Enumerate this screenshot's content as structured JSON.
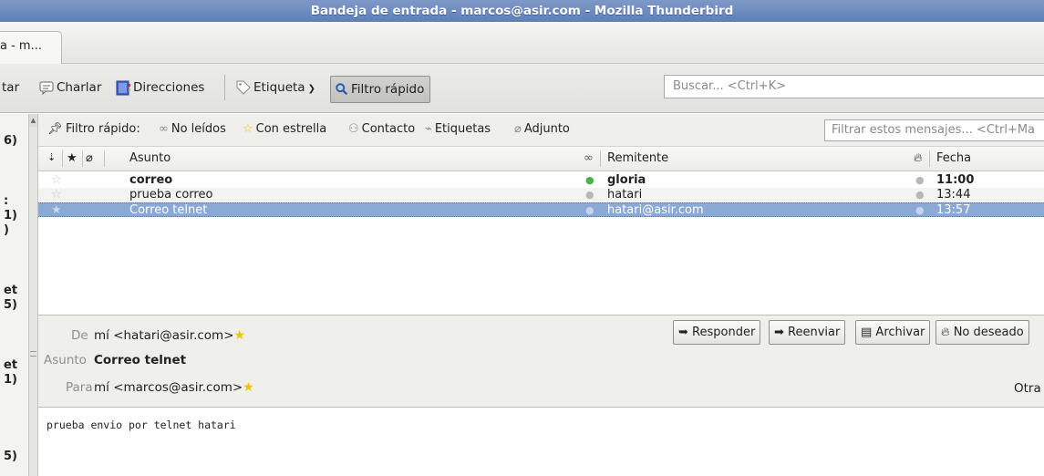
{
  "window": {
    "title": "Bandeja de entrada - marcos@asir.com - Mozilla Thunderbird"
  },
  "tab": {
    "label": "a - m..."
  },
  "toolbar": {
    "partial_label": "tar",
    "chat": "Charlar",
    "addresses": "Direcciones",
    "tag": "Etiqueta",
    "quick_filter": "Filtro rápido",
    "search_placeholder": "Buscar... <Ctrl+K>"
  },
  "folder_counts": [
    "6)",
    ":",
    "1)",
    ")",
    "et",
    "5)",
    "et",
    "1)",
    "5)"
  ],
  "quickfilter": {
    "label": "Filtro rápido:",
    "unread": "No leídos",
    "starred": "Con estrella",
    "contact": "Contacto",
    "tags": "Etiquetas",
    "attachment": "Adjunto",
    "filter_placeholder": "Filtrar estos mensajes... <Ctrl+Ma"
  },
  "columns": {
    "subject": "Asunto",
    "sender": "Remitente",
    "date": "Fecha"
  },
  "messages": [
    {
      "subject": "correo",
      "sender": "gloria",
      "date": "11:00",
      "unread": true
    },
    {
      "subject": "prueba correo",
      "sender": "hatari",
      "date": "13:44",
      "unread": false
    },
    {
      "subject": "Correo telnet",
      "sender": "hatari@asir.com",
      "date": "13:57",
      "unread": false,
      "selected": true
    }
  ],
  "header": {
    "from_label": "De",
    "from_value": "mí <hatari@asir.com>",
    "subject_label": "Asunto",
    "subject_value": "Correo telnet",
    "to_label": "Para",
    "to_value": "mí <marcos@asir.com>",
    "other": "Otra",
    "reply": "Responder",
    "forward": "Reenviar",
    "archive": "Archivar",
    "junk": "No deseado"
  },
  "body": {
    "text": "prueba envio por telnet hatari"
  },
  "colors": {
    "titlebar": "#6f8cbf",
    "selection": "#8aa9d4",
    "unread_dot": "#4caf50",
    "star": "#f5c400"
  }
}
